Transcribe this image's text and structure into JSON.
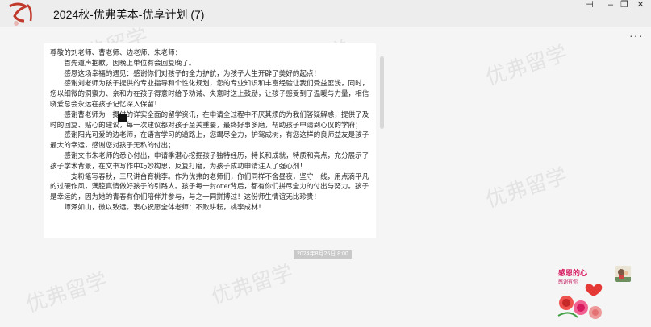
{
  "window": {
    "title": "2024秋-优弗美本-优享计划 (7)",
    "controls": {
      "pin": "⊣",
      "minimize": "–",
      "restore": "❐",
      "close": "✕"
    },
    "more": "···"
  },
  "watermarks": [
    "优弗留学",
    "优弗留学",
    "优弗留学",
    "优弗留学",
    "优弗留学",
    "优弗留学"
  ],
  "message": {
    "paragraphs": [
      "尊敬的刘老师、曹老师、边老师、朱老师：",
      "首先道声抱歉，因晚上单位有会回复晚了。",
      "感恩这场幸福的遇见：感谢你们对孩子的全力护航，为孩子人生开辟了美好的起点！",
      "感谢刘老师为孩子提供的专业指导和个性化规划，您的专业知识和丰富经验让我们受益匪浅，同时，您以细微的洞察力、亲和力在孩子得意时给予劝诫、失意时送上鼓励，让孩子感受到了温暖与力量，相信晓爱总会永远在孩子记忆深入保留！",
      "感谢曹老师为　提供的详实全面的留学资讯，在申请全过程中不厌其烦的为我们答疑解惑，提供了及时的回复、贴心的建议，每一次建议都对孩子至关重要，最终好事多磨，帮助孩子申请到心仪的学府；",
      "感谢阳光可爱的边老师，在语言学习的道路上，您竭尽全力，护驾成树，有您这样的良师益友是孩子最大的幸运，感谢您对孩子无私的付出；",
      "感谢文书朱老师的悉心付出，申请季潜心挖掘孩子独特经历，特长和成就，特质和亮点，充分展示了孩子学术背景，在文书写作中巧妙构思，反复打磨，为孩子成功申请注入了强心剂！",
      "一支粉笔写春秋，三尺讲台育桃李。作为优弗的老师们，你们同样不舍昼夜，坚守一线，用点滴平凡的过硬作风，满腔真情做好孩子的引路人。孩子每一封offer背后，都有你们拼尽全力的付出与努力。孩子是幸运的，因为她的青春有你们陪伴并参与，与之一同拼搏过！这份师生情谊无比珍贵！",
      "师泽如山，微以致远。衷心祝愿全体老师：不败耕耘，桃李成林！"
    ]
  },
  "timestamp": "2024年8月26日 8:00",
  "sticker": {
    "title": "感恩的心",
    "subtitle": "感谢有你"
  }
}
